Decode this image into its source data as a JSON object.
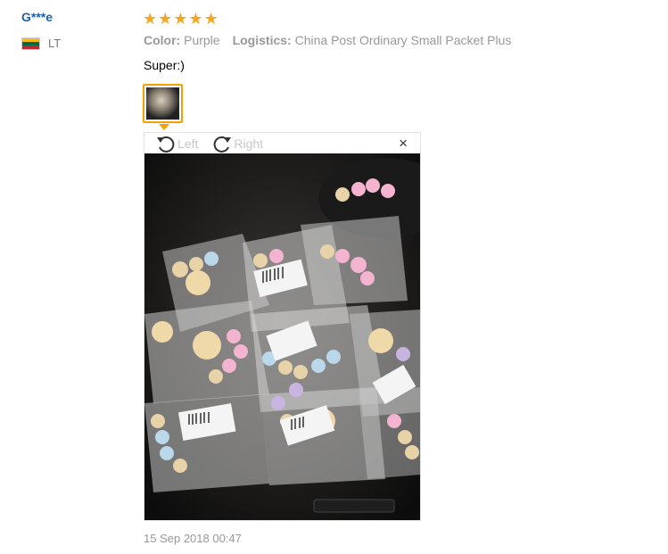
{
  "buyer": {
    "name": "G***e",
    "country_code": "LT",
    "flag_colors": [
      "#fdb913",
      "#006a44",
      "#c1272d"
    ]
  },
  "review": {
    "rating": 5,
    "stars": [
      "★",
      "★",
      "★",
      "★",
      "★"
    ],
    "star_color": "#f5a623",
    "color_label": "Color:",
    "color_value": "Purple",
    "logistics_label": "Logistics:",
    "logistics_value": "China Post Ordinary Small Packet Plus",
    "text": "Super:)",
    "date": "15 Sep 2018 00:47"
  },
  "viewer": {
    "rotate_left_label": "Left",
    "rotate_right_label": "Right",
    "close_label": "×",
    "icons": [
      "rotate-left-icon",
      "rotate-right-icon",
      "close-icon"
    ],
    "photo_description_icon": "product-photo"
  },
  "accent_color": "#f5a000",
  "name_color": "#1a5fb4"
}
